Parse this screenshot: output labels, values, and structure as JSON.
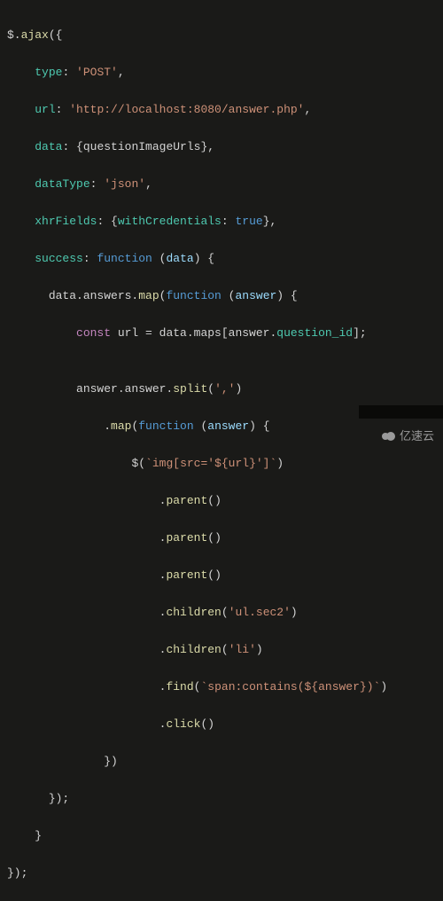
{
  "code": {
    "l1_a": "$.",
    "l1_b": "ajax",
    "l1_c": "({",
    "l2_a": "type",
    "l2_b": ": ",
    "l2_c": "'POST'",
    "l2_d": ",",
    "l3_a": "url",
    "l3_b": ": ",
    "l3_c": "'http://localhost:8080/answer.php'",
    "l3_d": ",",
    "l4_a": "data",
    "l4_b": ": {",
    "l4_c": "questionImageUrls",
    "l4_d": "},",
    "l5_a": "dataType",
    "l5_b": ": ",
    "l5_c": "'json'",
    "l5_d": ",",
    "l6_a": "xhrFields",
    "l6_b": ": {",
    "l6_c": "withCredentials",
    "l6_d": ": ",
    "l6_e": "true",
    "l6_f": "},",
    "l7_a": "success",
    "l7_b": ": ",
    "l7_c": "function",
    "l7_d": " (",
    "l7_e": "data",
    "l7_f": ") {",
    "l8_a": "data.answers.",
    "l8_b": "map",
    "l8_c": "(",
    "l8_d": "function",
    "l8_e": " (",
    "l8_f": "answer",
    "l8_g": ") {",
    "l9_a": "const",
    "l9_b": " url = data.maps[answer.",
    "l9_c": "question_id",
    "l9_d": "];",
    "l10": "",
    "l11_a": "answer.answer.",
    "l11_b": "split",
    "l11_c": "(",
    "l11_d": "','",
    "l11_e": ")",
    "l12_a": ".",
    "l12_b": "map",
    "l12_c": "(",
    "l12_d": "function",
    "l12_e": " (",
    "l12_f": "answer",
    "l12_g": ") {",
    "l13_a": "$",
    "l13_b": "(",
    "l13_c": "`img[src='${url}']`",
    "l13_d": ")",
    "l14_a": ".",
    "l14_b": "parent",
    "l14_c": "()",
    "l15_a": ".",
    "l15_b": "parent",
    "l15_c": "()",
    "l16_a": ".",
    "l16_b": "parent",
    "l16_c": "()",
    "l17_a": ".",
    "l17_b": "children",
    "l17_c": "(",
    "l17_d": "'ul.sec2'",
    "l17_e": ")",
    "l18_a": ".",
    "l18_b": "children",
    "l18_c": "(",
    "l18_d": "'li'",
    "l18_e": ")",
    "l19_a": ".",
    "l19_b": "find",
    "l19_c": "(",
    "l19_d": "`span:contains(${answer})`",
    "l19_e": ")",
    "l20_a": ".",
    "l20_b": "click",
    "l20_c": "()",
    "l21": "})",
    "l22": "});",
    "l23": "}",
    "l24": "});"
  },
  "watermark": "亿速云"
}
